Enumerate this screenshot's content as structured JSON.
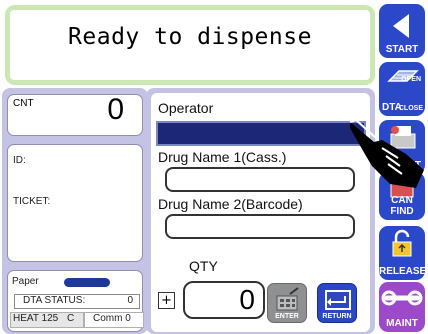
{
  "message": "Ready to dispense",
  "counter": {
    "label": "CNT",
    "value": "0"
  },
  "info": {
    "id_label": "ID:",
    "ticket_label": "TICKET:"
  },
  "status": {
    "paper_label": "Paper",
    "dta_status_label": "DTA STATUS:",
    "dta_status_value": "0",
    "heat_label": "HEAT 125",
    "heat_unit": "C",
    "comm_label": "Comm 0"
  },
  "form": {
    "operator_label": "Operator",
    "operator_value": "",
    "drug1_label": "Drug Name 1(Cass.)",
    "drug1_value": "",
    "drug2_label": "Drug Name 2(Barcode)",
    "drug2_value": "",
    "qty_label": "QTY",
    "plus_label": "+",
    "qty_value": "0",
    "enter_label": "ENTER",
    "return_label": "RETURN"
  },
  "side_buttons": {
    "start": "START",
    "dta_open_close_main": "DTA",
    "dta_open": "OPEN",
    "dta_close": "CLOSE",
    "print": "T",
    "can_find": "CAN FIND",
    "release": "RELEASE",
    "maint": "MAINT"
  },
  "colors": {
    "accent": "#2b48c8",
    "maint": "#9c4ac9",
    "panel": "#c5c3e3",
    "message_border": "#cbe7b4"
  }
}
